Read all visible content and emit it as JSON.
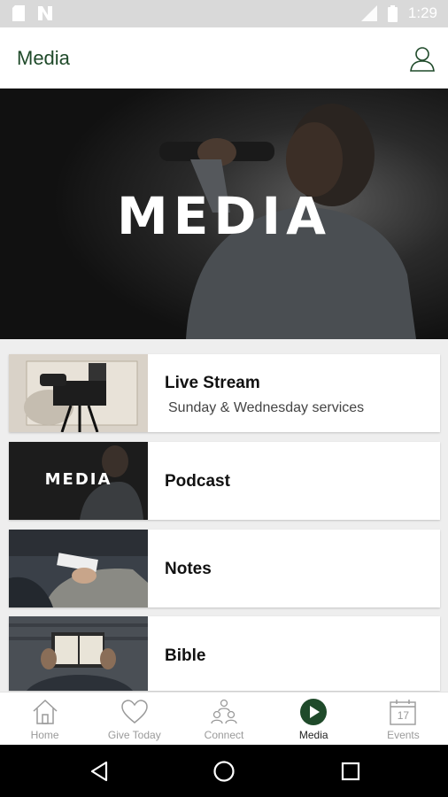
{
  "status_bar": {
    "time": "1:29"
  },
  "app_bar": {
    "title": "Media"
  },
  "hero": {
    "title": "MEDIA"
  },
  "items": [
    {
      "label": "Live Stream",
      "subtitle": "Sunday  & Wednesday services"
    },
    {
      "label": "Podcast",
      "thumb_text": "MEDIA"
    },
    {
      "label": "Notes"
    },
    {
      "label": "Bible"
    }
  ],
  "tabs": [
    {
      "label": "Home",
      "icon": "home-icon"
    },
    {
      "label": "Give Today",
      "icon": "heart-icon"
    },
    {
      "label": "Connect",
      "icon": "people-icon"
    },
    {
      "label": "Media",
      "icon": "play-icon",
      "active": true
    },
    {
      "label": "Events",
      "icon": "calendar-icon",
      "date": "17"
    }
  ],
  "colors": {
    "brand": "#1f4a2a",
    "active_tab": "#1f4a2a",
    "inactive": "#9a9a9a"
  }
}
